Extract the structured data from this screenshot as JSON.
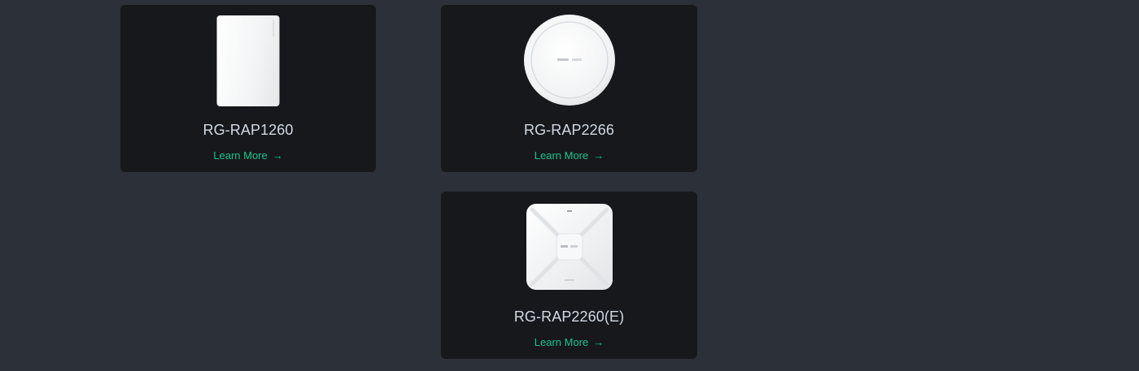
{
  "products": [
    {
      "name": "RG-RAP1260",
      "image_icon": "wall-plate-access-point-image",
      "link_label": "Learn More",
      "link_arrow": "→"
    },
    {
      "name": "RG-RAP2266",
      "image_icon": "round-ceiling-access-point-image",
      "link_label": "Learn More",
      "link_arrow": "→"
    },
    {
      "name": "RG-RAP2260(E)",
      "image_icon": "square-ceiling-access-point-image",
      "link_label": "Learn More",
      "link_arrow": "→"
    }
  ],
  "colors": {
    "page_background": "#2c3038",
    "card_background": "#16181c",
    "title_text": "#d2d9e3",
    "link_accent": "#18c58a"
  }
}
